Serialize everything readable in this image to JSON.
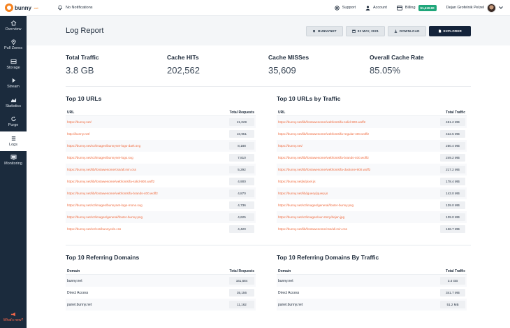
{
  "brand": {
    "name": "bunny",
    "tld": ".net"
  },
  "topbar": {
    "notifications": "No Notifications",
    "support": "Support",
    "account": "Account",
    "billing": "Billing",
    "balance": "$1,410.90",
    "user_name": "Dejan Grofelnik Pelzel"
  },
  "sidebar": {
    "items": [
      {
        "label": "Overview",
        "icon": "home-icon"
      },
      {
        "label": "Pull Zones",
        "icon": "location-pin-icon"
      },
      {
        "label": "Storage",
        "icon": "storage-icon"
      },
      {
        "label": "Stream",
        "icon": "play-icon"
      },
      {
        "label": "Statistics",
        "icon": "chart-icon"
      },
      {
        "label": "Purge",
        "icon": "refresh-icon"
      },
      {
        "label": "Logs",
        "icon": "logs-icon"
      },
      {
        "label": "Monitoring",
        "icon": "monitor-icon"
      }
    ],
    "whats_new": "What's new?"
  },
  "header": {
    "title": "Log Report",
    "zone_button": "BUNNYNET",
    "date_button": "02 MAY, 2021",
    "download_button": "DOWNLOAD",
    "explorer_button": "EXPLORER"
  },
  "stats": [
    {
      "label": "Total Traffic",
      "value": "3.8 GB"
    },
    {
      "label": "Cache HITs",
      "value": "202,562"
    },
    {
      "label": "Cache MISSes",
      "value": "35,609"
    },
    {
      "label": "Overall Cache Rate",
      "value": "85.05%"
    }
  ],
  "top_urls": {
    "title": "Top 10 URLs",
    "col_url": "URL",
    "col_value": "Total Requests",
    "rows": [
      {
        "url": "https://bunny.net/",
        "value": "21,029"
      },
      {
        "url": "http://bunny.net/",
        "value": "10,951"
      },
      {
        "url": "https://bunny.net/v2/images/bunnynet-logo-dark.svg",
        "value": "8,188"
      },
      {
        "url": "https://bunny.net/v2/images/bunnynet-logo.svg",
        "value": "7,810"
      },
      {
        "url": "https://bunny.net/lib/fontawesome/css/all.min.css",
        "value": "5,292"
      },
      {
        "url": "https://bunny.net/lib/fontawesome/webfonts/fa-solid-900.woff2",
        "value": "4,900"
      },
      {
        "url": "https://bunny.net/lib/fontawesome/webfonts/fa-brands-400.woff2",
        "value": "4,870"
      },
      {
        "url": "https://bunny.net/v2/images/bunnynet-logo-mono.svg",
        "value": "4,736"
      },
      {
        "url": "https://bunny.net/v2/images/general/footer-bunny.png",
        "value": "4,625"
      },
      {
        "url": "https://bunny.net/v2/css/bunnycdn.css",
        "value": "4,420"
      }
    ]
  },
  "top_urls_traffic": {
    "title": "Top 10 URLs by Traffic",
    "col_url": "URL",
    "col_value": "Total Traffic",
    "rows": [
      {
        "url": "https://bunny.net/lib/fontawesome/webfonts/fa-solid-900.woff2",
        "value": "451.2 MB"
      },
      {
        "url": "https://bunny.net/lib/fontawesome/webfonts/fa-regular-400.woff2",
        "value": "422.5 MB"
      },
      {
        "url": "https://bunny.net/",
        "value": "250.4 MB"
      },
      {
        "url": "https://bunny.net/lib/fontawesome/webfonts/fa-brands-400.woff2",
        "value": "249.2 MB"
      },
      {
        "url": "https://bunny.net/lib/fontawesome/webfonts/fa-duotone-900.woff2",
        "value": "217.2 MB"
      },
      {
        "url": "https://bunny.net/js/pixel.js",
        "value": "178.4 MB"
      },
      {
        "url": "https://bunny.net/lib/jquery/jquery.js",
        "value": "143.0 MB"
      },
      {
        "url": "https://bunny.net/v2/images/general/footer-bunny.png",
        "value": "139.0 MB"
      },
      {
        "url": "https://bunny.net/v2/images/our-story/dejan.jpg",
        "value": "139.0 MB"
      },
      {
        "url": "https://bunny.net/lib/fontawesome/css/all.min.css",
        "value": "136.7 MB"
      }
    ]
  },
  "top_domains": {
    "title": "Top 10 Referring Domains",
    "col_domain": "Domain",
    "col_value": "Total Requests",
    "rows": [
      {
        "domain": "bunny.net",
        "value": "161,684"
      },
      {
        "domain": "Direct Access",
        "value": "35,156"
      },
      {
        "domain": "panel.bunny.net",
        "value": "11,162"
      }
    ]
  },
  "top_domains_traffic": {
    "title": "Top 10 Referring Domains By Traffic",
    "col_domain": "Domain",
    "col_value": "Total Traffic",
    "rows": [
      {
        "domain": "bunny.net",
        "value": "3.4 GB"
      },
      {
        "domain": "Direct Access",
        "value": "341.7 MB"
      },
      {
        "domain": "panel.bunny.net",
        "value": "51.2 MB"
      }
    ]
  },
  "colors": {
    "sidebar": "#1b2b3d",
    "accent": "#f5821f",
    "link": "#f06a3d",
    "balance": "#1fa67a",
    "explorer": "#14233a"
  }
}
